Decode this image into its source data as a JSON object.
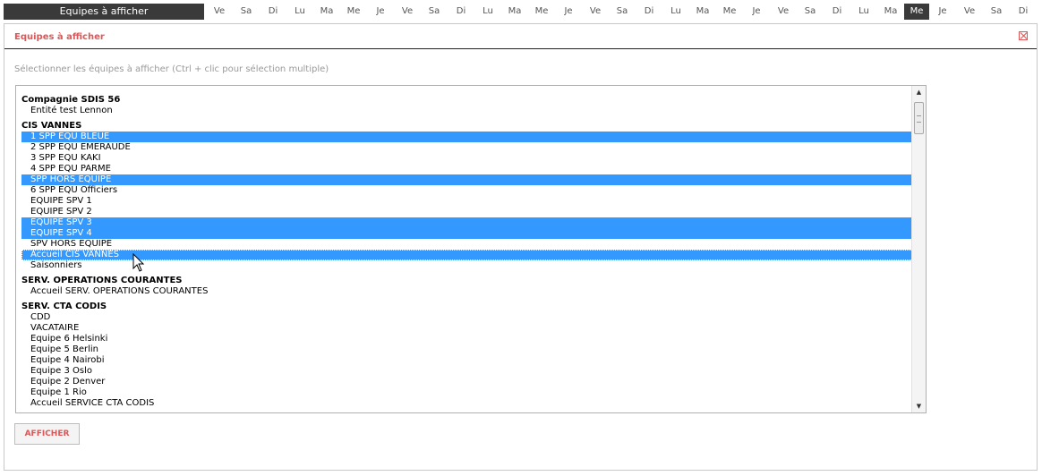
{
  "topbar": {
    "title": "Equipes à afficher",
    "days": [
      "Ve",
      "Sa",
      "Di",
      "Lu",
      "Ma",
      "Me",
      "Je",
      "Ve",
      "Sa",
      "Di",
      "Lu",
      "Ma",
      "Me",
      "Je",
      "Ve",
      "Sa",
      "Di",
      "Lu",
      "Ma",
      "Me",
      "Je",
      "Ve",
      "Sa",
      "Di",
      "Lu",
      "Ma",
      "Me",
      "Je",
      "Ve",
      "Sa",
      "Di"
    ],
    "active_day_index": 26
  },
  "modal": {
    "title": "Equipes à afficher",
    "instruction": "Sélectionner les équipes à afficher (Ctrl + clic pour sélection multiple)",
    "submit_label": "AFFICHER"
  },
  "list": {
    "groups": [
      {
        "label": "Compagnie SDIS 56",
        "items": [
          {
            "label": "Entité test Lennon",
            "selected": false
          }
        ]
      },
      {
        "label": "CIS VANNES",
        "items": [
          {
            "label": "1 SPP EQU BLEUE",
            "selected": true
          },
          {
            "label": "2 SPP EQU EMERAUDE",
            "selected": false
          },
          {
            "label": "3 SPP EQU KAKI",
            "selected": false
          },
          {
            "label": "4 SPP EQU PARME",
            "selected": false
          },
          {
            "label": "SPP HORS EQUIPE",
            "selected": true
          },
          {
            "label": "6 SPP EQU Officiers",
            "selected": false
          },
          {
            "label": "EQUIPE SPV 1",
            "selected": false
          },
          {
            "label": "EQUIPE SPV 2",
            "selected": false
          },
          {
            "label": "EQUIPE SPV 3",
            "selected": true
          },
          {
            "label": "EQUIPE SPV 4",
            "selected": true
          },
          {
            "label": "SPV HORS EQUIPE",
            "selected": false
          },
          {
            "label": "Accueil CIS VANNES",
            "selected": true,
            "focused": true
          },
          {
            "label": "Saisonniers",
            "selected": false
          }
        ]
      },
      {
        "label": "SERV. OPERATIONS COURANTES",
        "items": [
          {
            "label": "Accueil SERV. OPERATIONS COURANTES",
            "selected": false
          }
        ]
      },
      {
        "label": "SERV. CTA CODIS",
        "items": [
          {
            "label": "CDD",
            "selected": false
          },
          {
            "label": "VACATAIRE",
            "selected": false
          },
          {
            "label": "Equipe 6 Helsinki",
            "selected": false
          },
          {
            "label": "Equipe 5 Berlin",
            "selected": false
          },
          {
            "label": "Equipe 4 Nairobi",
            "selected": false
          },
          {
            "label": "Equipe 3 Oslo",
            "selected": false
          },
          {
            "label": "Equipe 2 Denver",
            "selected": false
          },
          {
            "label": "Equipe 1 Rio",
            "selected": false
          },
          {
            "label": "Accueil SERVICE CTA CODIS",
            "selected": false
          }
        ]
      }
    ]
  },
  "icons": {
    "close": "close-icon",
    "cursor": "mouse-pointer-icon",
    "scroll_up": "triangle-up-icon",
    "scroll_down": "triangle-down-icon"
  },
  "colors": {
    "accent": "#e05555",
    "selection": "#3399ff",
    "topbar_dark": "#3a3a3a"
  }
}
